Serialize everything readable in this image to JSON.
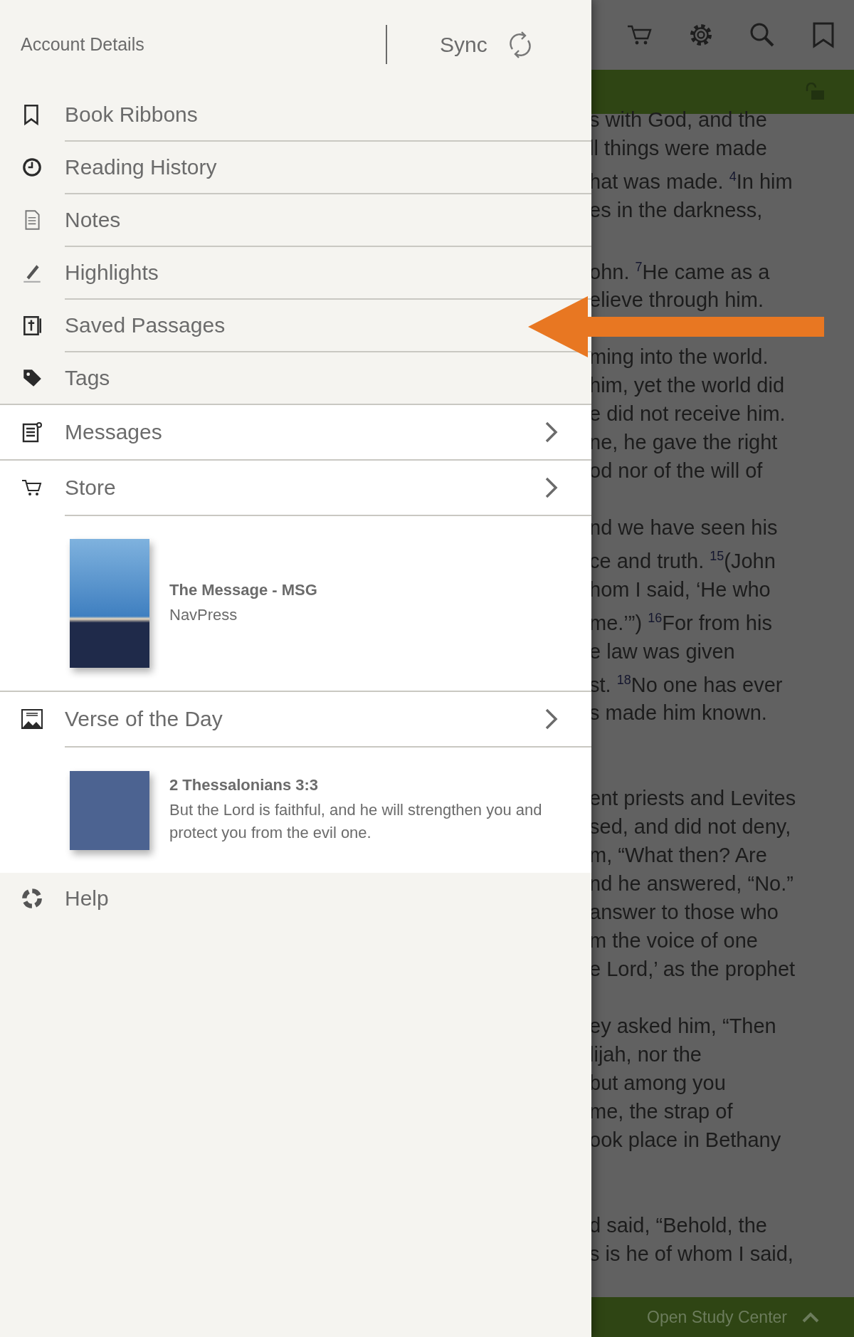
{
  "drawer": {
    "account_label": "Account Details",
    "sync_label": "Sync",
    "menu_items": [
      {
        "label": "Book Ribbons"
      },
      {
        "label": "Reading History"
      },
      {
        "label": "Notes"
      },
      {
        "label": "Highlights"
      },
      {
        "label": "Saved Passages"
      },
      {
        "label": "Tags"
      }
    ],
    "panels": [
      {
        "label": "Messages"
      },
      {
        "label": "Store",
        "card": {
          "kind": "book",
          "title": "The Message - MSG",
          "subtitle": "NavPress"
        }
      },
      {
        "label": "Verse of the Day",
        "card": {
          "kind": "verse",
          "title": "2 Thessalonians 3:3",
          "subtitle": "But the Lord is faithful, and he will strengthen you and protect you from the evil one."
        }
      }
    ],
    "help_label": "Help"
  },
  "reader": {
    "paragraphs": [
      {
        "section_start": false,
        "lines": [
          "s with God, and the",
          "ll things were made",
          "hat was made. $^{4}$In him",
          "es in the darkness,"
        ]
      },
      {
        "section_start": false,
        "lines": [
          "ohn. $^{7}$He came as a",
          "elieve through him."
        ]
      },
      {
        "section_start": false,
        "lines": [
          "ming into the world.",
          "him, yet the world did",
          "e did not receive him.",
          "ne, he gave the right",
          "od nor of the will of"
        ]
      },
      {
        "section_start": false,
        "lines": [
          "nd we have seen his",
          "ce and truth. $^{15}$(John",
          "hom I said, ‘He who",
          "me.’”) $^{16}$For from his",
          "e law was given",
          "st. $^{18}$No one has ever",
          "s made him known."
        ]
      },
      {
        "section_start": true,
        "lines": [
          "ent priests and Levites",
          "sed, and did not deny,",
          "m, “What then? Are",
          "nd he answered, “No.”",
          "answer to those who",
          "m the voice of one",
          "e Lord,’ as the prophet"
        ]
      },
      {
        "section_start": false,
        "lines": [
          "ey asked him, “Then",
          "lijah, nor the",
          "but among you",
          "me, the strap of",
          "ook place in Bethany"
        ]
      },
      {
        "section_start": true,
        "lines": [
          "d said, “Behold, the",
          "s is he of whom I said,"
        ]
      }
    ],
    "study_center_label": "Open Study Center"
  }
}
